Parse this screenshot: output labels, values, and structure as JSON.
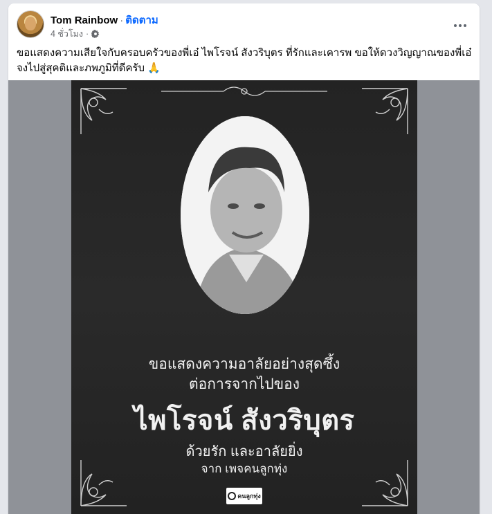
{
  "post": {
    "author": "Tom Rainbow",
    "follow_label": "ติดตาม",
    "time": "4 ชั่วโมง",
    "privacy_icon": "gear-icon",
    "more_icon": "more-horizontal-icon",
    "text": "ขอแสดงความเสียใจกับครอบครัวของพี่เอ๋ ไพโรจน์ สังวริบุตร ที่รักและเคารพ ขอให้ดวงวิญญาณของพี่เอ๋จงไปสู่สุคติและภพภูมิที่ดีครับ 🙏"
  },
  "poster": {
    "line1": "ขอแสดงความอาลัยอย่างสุดซึ้ง",
    "line2": "ต่อการจากไปของ",
    "name": "ไพโรจน์ สังวริบุตร",
    "line4": "ด้วยรัก และอาลัยยิ่ง",
    "line5": "จาก เพจคนลูกทุ่ง",
    "logo_text": "คนลูกทุ่ง"
  },
  "colors": {
    "follow": "#0866ff",
    "poster_bg": "#252525",
    "photo_bg": "#8f9298"
  }
}
